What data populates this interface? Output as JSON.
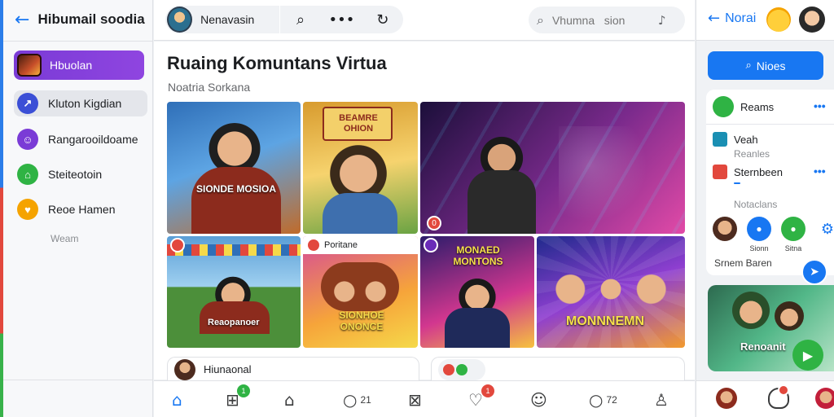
{
  "sidebar": {
    "title": "Hibumail soodia",
    "active_item": "Hbuolan",
    "items": [
      {
        "label": "Kluton Kigdian",
        "icon": "trend-icon",
        "color": "#3b4fd6"
      },
      {
        "label": "Rangarooildoame",
        "icon": "users-icon",
        "color": "#7a3bd6"
      },
      {
        "label": "Steiteotoin",
        "icon": "home-icon",
        "color": "#2fb344"
      },
      {
        "label": "Reoe Hamen",
        "icon": "heart-icon",
        "color": "#f5a300"
      }
    ],
    "more": "Weam"
  },
  "topbar": {
    "profile_name": "Nenavasin",
    "search_placeholder": "Vhumna   sion"
  },
  "main": {
    "title": "Ruaing Komuntans Virtua",
    "subtitle": "Noatria Sorkana",
    "tiles": [
      {
        "caption": "SIONDE MOSIOA",
        "colors": [
          "#2f6fb8",
          "#5da4e3",
          "#c06b2a"
        ]
      },
      {
        "caption": "BEAMRE OHION",
        "colors": [
          "#d89b2e",
          "#f6d36e",
          "#6aa343"
        ]
      },
      {
        "caption": "",
        "badge": "0",
        "colors": [
          "#1b0f3a",
          "#7a2a8c",
          "#e24aa7"
        ]
      },
      {
        "caption": "Reaopanoer",
        "colors": [
          "#5a9ed6",
          "#9fd0f0",
          "#4c8f3a"
        ]
      },
      {
        "caption": "SIONHOE ONONCE",
        "label": "Poritane",
        "colors": [
          "#d54a9a",
          "#f6a43a",
          "#f5d94a"
        ]
      },
      {
        "caption": "MONAED MONTONS",
        "colors": [
          "#2c1c6b",
          "#d2378f",
          "#f6c23e"
        ]
      },
      {
        "caption": "MONNNEMN",
        "colors": [
          "#1f2a8c",
          "#8e3fd0",
          "#f29a2e"
        ]
      }
    ],
    "bottom_card_1": "Hiunaonal",
    "bottom_card_2": ""
  },
  "bottom_nav": {
    "items": [
      {
        "icon": "home-icon"
      },
      {
        "icon": "groups-icon",
        "badge": "1"
      },
      {
        "icon": "tent-icon"
      },
      {
        "icon": "comment-icon",
        "count": "21"
      },
      {
        "icon": "inbox-icon"
      },
      {
        "icon": "favorite-icon",
        "badge": "1"
      },
      {
        "icon": "people-icon"
      },
      {
        "icon": "chat-icon",
        "count": "72"
      },
      {
        "icon": "profile-icon"
      }
    ]
  },
  "right_panel": {
    "back_label": "Norai",
    "button_label": "Nioes",
    "header_item": "Reams",
    "rows": [
      {
        "label": "Veah",
        "sub": "Reanles"
      },
      {
        "label": "Sternbeen",
        "sub": "Notaclans"
      }
    ],
    "shortcuts": [
      "",
      "Sionn",
      "Sitna"
    ],
    "footer": "Srnem Baren",
    "video_caption": "Renoanit"
  }
}
